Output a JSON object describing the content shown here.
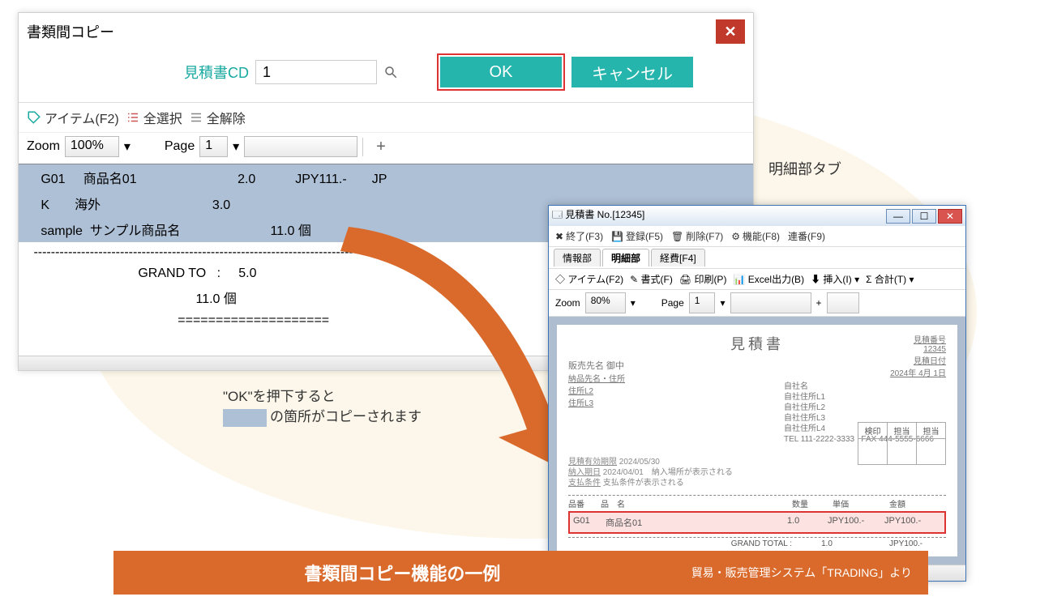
{
  "dlgA": {
    "title": "書類間コピー",
    "cd_label": "見積書CD",
    "cd_value": "1",
    "ok_label": "OK",
    "cancel_label": "キャンセル",
    "tool_item": "アイテム(F2)",
    "tool_selall": "全選択",
    "tool_deselall": "全解除",
    "zoom_label": "Zoom",
    "zoom_value": "100%",
    "page_label": "Page",
    "page_value": "1",
    "rows": [
      {
        "c1": "G01",
        "c2": "商品名01",
        "c3": "2.0",
        "c4": "",
        "c5": "JPY111.-",
        "c6": "JP",
        "hl": true
      },
      {
        "c1": "K",
        "c2": "海外",
        "c3": "3.0",
        "c4": "",
        "c5": "",
        "c6": "",
        "hl": true
      },
      {
        "c1": "sample",
        "c2": "サンプル商品名",
        "c3": "11.0",
        "c4": "個",
        "c5": "",
        "c6": "",
        "hl": true
      }
    ],
    "grand_label": "GRAND TO",
    "grand_v1": "5.0",
    "grand_v2": "11.0 個"
  },
  "annotation": {
    "line1": "\"OK\"を押下すると",
    "line2_tail": "の箇所がコピーされます"
  },
  "labelB": "明細部タブ",
  "winB": {
    "title": "見積書 No.[12345]",
    "tb1": {
      "exit": "終了(F3)",
      "save": "登録(F5)",
      "delete": "削除(F7)",
      "func": "機能(F8)",
      "seq": "連番(F9)"
    },
    "tabs": {
      "info": "情報部",
      "detail": "明細部",
      "cost": "経費[F4]"
    },
    "tb2": {
      "item": "アイテム(F2)",
      "format": "書式(F)",
      "print": "印刷(P)",
      "excel": "Excel出力(B)",
      "insert": "挿入(I) ▾",
      "total": "合計(T) ▾"
    },
    "zoom_label": "Zoom",
    "zoom_value": "80%",
    "page_label": "Page",
    "page_value": "1",
    "doc": {
      "title": "見積書",
      "number_label": "見積番号",
      "number": "12345",
      "date_label": "見積日付",
      "date": "2024年 4月 1日",
      "client": "販売先名 御中",
      "client_sub": "納品先名・住所\n住所L2\n住所L3",
      "self": "自社名\n自社住所L1\n自社住所L2\n自社住所L3\n自社住所L4\nTEL 111-2222-3333   FAX 444-5555-6666",
      "sign_h": [
        "検印",
        "担当",
        "担当"
      ],
      "misc1_label": "見積有効期限",
      "misc1": "2024/05/30",
      "misc2_label": "納入期日",
      "misc2": "2024/04/01",
      "misc2_note": "納入場所が表示される",
      "misc3_label": "支払条件",
      "misc3": "支払条件が表示される",
      "col_labels": {
        "code": "品番",
        "name": "品　名",
        "qty": "数量",
        "unit": "単価",
        "amount": "金額"
      },
      "row": {
        "code": "G01",
        "name": "商品名01",
        "qty": "1.0",
        "unit": "JPY100.-",
        "amount": "JPY100.-"
      },
      "total_label": "GRAND TOTAL :",
      "total_qty": "1.0",
      "total_amount": "JPY100.-"
    }
  },
  "banner": {
    "main": "書類間コピー機能の一例",
    "sub": "貿易・販売管理システム「TRADING」より"
  }
}
